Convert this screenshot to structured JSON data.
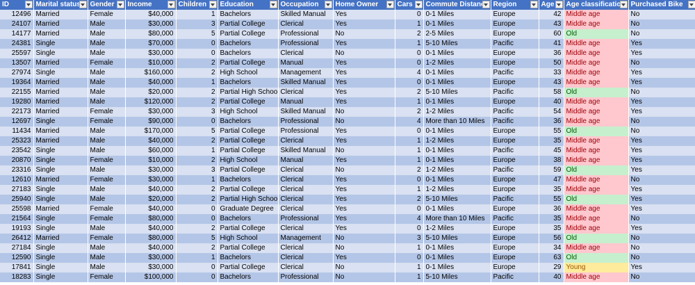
{
  "columns": [
    {
      "key": "id",
      "label": "ID"
    },
    {
      "key": "marital",
      "label": "Marital status"
    },
    {
      "key": "gender",
      "label": "Gender"
    },
    {
      "key": "income",
      "label": "Income"
    },
    {
      "key": "children",
      "label": "Children"
    },
    {
      "key": "education",
      "label": "Education"
    },
    {
      "key": "occupation",
      "label": "Occupation"
    },
    {
      "key": "home_owner",
      "label": "Home Owner"
    },
    {
      "key": "cars",
      "label": "Cars"
    },
    {
      "key": "commute",
      "label": "Commute Distance"
    },
    {
      "key": "region",
      "label": "Region"
    },
    {
      "key": "age",
      "label": "Age"
    },
    {
      "key": "age_class",
      "label": "Age classification"
    },
    {
      "key": "purchased",
      "label": "Purchased Bike"
    }
  ],
  "colors": {
    "header_bg": "#4472c4",
    "row_light": "#d9e1f2",
    "row_dark": "#b4c6e7",
    "middle_age_bg": "#ffc7ce",
    "old_bg": "#c6efce",
    "young_bg": "#ffeb9c"
  },
  "rows": [
    [
      "12496",
      "Married",
      "Female",
      "$40,000",
      "1",
      "Bachelors",
      "Skilled Manual",
      "Yes",
      "0",
      "0-1 Miles",
      "Europe",
      "42",
      "Middle age",
      "No"
    ],
    [
      "24107",
      "Married",
      "Male",
      "$30,000",
      "3",
      "Partial College",
      "Clerical",
      "Yes",
      "1",
      "0-1 Miles",
      "Europe",
      "43",
      "Middle age",
      "No"
    ],
    [
      "14177",
      "Married",
      "Male",
      "$80,000",
      "5",
      "Partial College",
      "Professional",
      "No",
      "2",
      "2-5 Miles",
      "Europe",
      "60",
      "Old",
      "No"
    ],
    [
      "24381",
      "Single",
      "Male",
      "$70,000",
      "0",
      "Bachelors",
      "Professional",
      "Yes",
      "1",
      "5-10 Miles",
      "Pacific",
      "41",
      "Middle age",
      "Yes"
    ],
    [
      "25597",
      "Single",
      "Male",
      "$30,000",
      "0",
      "Bachelors",
      "Clerical",
      "No",
      "0",
      "0-1 Miles",
      "Europe",
      "36",
      "Middle age",
      "Yes"
    ],
    [
      "13507",
      "Married",
      "Female",
      "$10,000",
      "2",
      "Partial College",
      "Manual",
      "Yes",
      "0",
      "1-2 Miles",
      "Europe",
      "50",
      "Middle age",
      "No"
    ],
    [
      "27974",
      "Single",
      "Male",
      "$160,000",
      "2",
      "High School",
      "Management",
      "Yes",
      "4",
      "0-1 Miles",
      "Pacific",
      "33",
      "Middle age",
      "Yes"
    ],
    [
      "19364",
      "Married",
      "Male",
      "$40,000",
      "1",
      "Bachelors",
      "Skilled Manual",
      "Yes",
      "0",
      "0-1 Miles",
      "Europe",
      "43",
      "Middle age",
      "Yes"
    ],
    [
      "22155",
      "Married",
      "Male",
      "$20,000",
      "2",
      "Partial High School",
      "Clerical",
      "Yes",
      "2",
      "5-10 Miles",
      "Pacific",
      "58",
      "Old",
      "No"
    ],
    [
      "19280",
      "Married",
      "Male",
      "$120,000",
      "2",
      "Partial College",
      "Manual",
      "Yes",
      "1",
      "0-1 Miles",
      "Europe",
      "40",
      "Middle age",
      "Yes"
    ],
    [
      "22173",
      "Married",
      "Female",
      "$30,000",
      "3",
      "High School",
      "Skilled Manual",
      "No",
      "2",
      "1-2 Miles",
      "Pacific",
      "54",
      "Middle age",
      "Yes"
    ],
    [
      "12697",
      "Single",
      "Female",
      "$90,000",
      "0",
      "Bachelors",
      "Professional",
      "No",
      "4",
      "More than 10 Miles",
      "Pacific",
      "36",
      "Middle age",
      "No"
    ],
    [
      "11434",
      "Married",
      "Male",
      "$170,000",
      "5",
      "Partial College",
      "Professional",
      "Yes",
      "0",
      "0-1 Miles",
      "Europe",
      "55",
      "Old",
      "No"
    ],
    [
      "25323",
      "Married",
      "Male",
      "$40,000",
      "2",
      "Partial College",
      "Clerical",
      "Yes",
      "1",
      "1-2 Miles",
      "Europe",
      "35",
      "Middle age",
      "Yes"
    ],
    [
      "23542",
      "Single",
      "Male",
      "$60,000",
      "1",
      "Partial College",
      "Skilled Manual",
      "No",
      "1",
      "0-1 Miles",
      "Pacific",
      "45",
      "Middle age",
      "Yes"
    ],
    [
      "20870",
      "Single",
      "Female",
      "$10,000",
      "2",
      "High School",
      "Manual",
      "Yes",
      "1",
      "0-1 Miles",
      "Europe",
      "38",
      "Middle age",
      "Yes"
    ],
    [
      "23316",
      "Single",
      "Male",
      "$30,000",
      "3",
      "Partial College",
      "Clerical",
      "No",
      "2",
      "1-2 Miles",
      "Pacific",
      "59",
      "Old",
      "Yes"
    ],
    [
      "12610",
      "Married",
      "Female",
      "$30,000",
      "1",
      "Bachelors",
      "Clerical",
      "Yes",
      "0",
      "0-1 Miles",
      "Europe",
      "47",
      "Middle age",
      "No"
    ],
    [
      "27183",
      "Single",
      "Male",
      "$40,000",
      "2",
      "Partial College",
      "Clerical",
      "Yes",
      "1",
      "1-2 Miles",
      "Europe",
      "35",
      "Middle age",
      "Yes"
    ],
    [
      "25940",
      "Single",
      "Male",
      "$20,000",
      "2",
      "Partial High School",
      "Clerical",
      "Yes",
      "2",
      "5-10 Miles",
      "Pacific",
      "55",
      "Old",
      "Yes"
    ],
    [
      "25598",
      "Married",
      "Female",
      "$40,000",
      "0",
      "Graduate Degree",
      "Clerical",
      "Yes",
      "0",
      "0-1 Miles",
      "Europe",
      "36",
      "Middle age",
      "Yes"
    ],
    [
      "21564",
      "Single",
      "Female",
      "$80,000",
      "0",
      "Bachelors",
      "Professional",
      "Yes",
      "4",
      "More than 10 Miles",
      "Pacific",
      "35",
      "Middle age",
      "No"
    ],
    [
      "19193",
      "Single",
      "Male",
      "$40,000",
      "2",
      "Partial College",
      "Clerical",
      "Yes",
      "0",
      "1-2 Miles",
      "Europe",
      "35",
      "Middle age",
      "Yes"
    ],
    [
      "26412",
      "Married",
      "Female",
      "$80,000",
      "5",
      "High School",
      "Management",
      "No",
      "3",
      "5-10 Miles",
      "Europe",
      "56",
      "Old",
      "No"
    ],
    [
      "27184",
      "Single",
      "Male",
      "$40,000",
      "2",
      "Partial College",
      "Clerical",
      "No",
      "1",
      "0-1 Miles",
      "Europe",
      "34",
      "Middle age",
      "No"
    ],
    [
      "12590",
      "Single",
      "Male",
      "$30,000",
      "1",
      "Bachelors",
      "Clerical",
      "Yes",
      "0",
      "0-1 Miles",
      "Europe",
      "63",
      "Old",
      "No"
    ],
    [
      "17841",
      "Single",
      "Male",
      "$30,000",
      "0",
      "Partial College",
      "Clerical",
      "No",
      "1",
      "0-1 Miles",
      "Europe",
      "29",
      "Young",
      "Yes"
    ],
    [
      "18283",
      "Single",
      "Female",
      "$100,000",
      "0",
      "Bachelors",
      "Professional",
      "No",
      "1",
      "5-10 Miles",
      "Pacific",
      "40",
      "Middle age",
      "No"
    ]
  ]
}
